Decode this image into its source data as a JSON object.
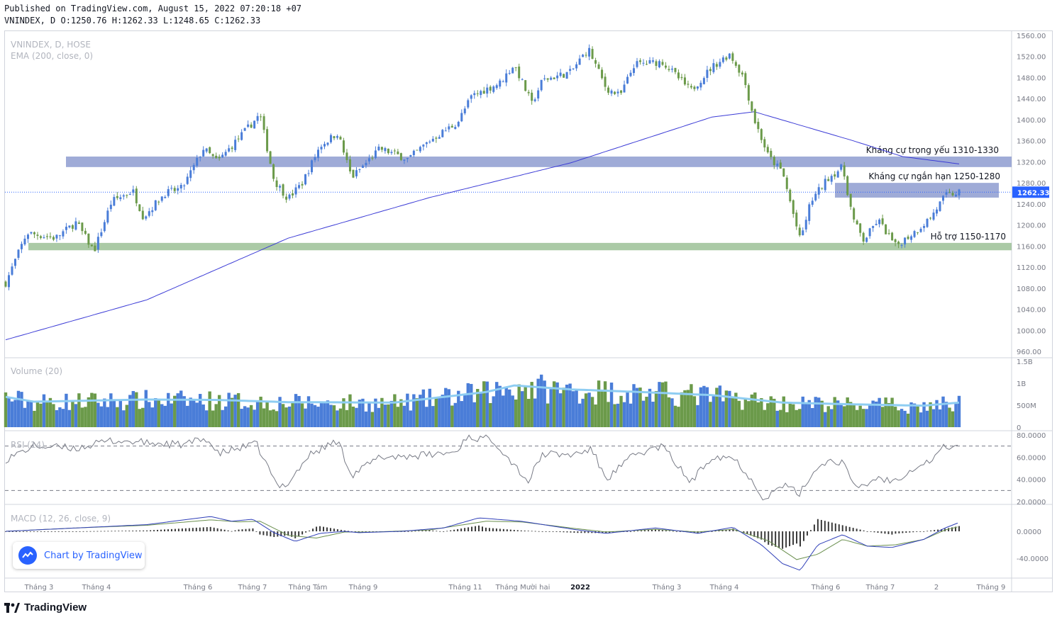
{
  "header": {
    "published": "Published on TradingView.com, August 15, 2022 07:20:18 +07",
    "ohlc": "VNINDEX, D O:1250.76 H:1262.33 L:1248.65 C:1262.33"
  },
  "legend": {
    "symbol": "VNINDEX, D, HOSE",
    "ema": "EMA (200, close, 0)",
    "volume": "Volume (20)",
    "rsi": "RSI (14)",
    "macd": "MACD (12, 26, close, 9)"
  },
  "price_axis": {
    "ticks": [
      "1560.00",
      "1520.00",
      "1480.00",
      "1440.00",
      "1400.00",
      "1360.00",
      "1320.00",
      "1280.00",
      "1240.00",
      "1200.00",
      "1160.00",
      "1120.00",
      "1080.00",
      "1040.00",
      "1000.00",
      "960.00"
    ],
    "last_price": "1262.33"
  },
  "volume_axis": {
    "ticks": [
      "1.5B",
      "1B",
      "500M",
      "0"
    ]
  },
  "rsi_axis": {
    "ticks": [
      "80.0000",
      "60.0000",
      "40.0000",
      "20.0000"
    ]
  },
  "macd_axis": {
    "ticks": [
      "0.0000",
      "-40.0000"
    ]
  },
  "time_axis": {
    "labels": [
      "Tháng 3",
      "Tháng 4",
      "Tháng 6",
      "Tháng 7",
      "Tháng Tám",
      "Tháng 9",
      "Tháng 11",
      "Tháng Mười hai",
      "2022",
      "Tháng 3",
      "Tháng 4",
      "Tháng 6",
      "Tháng 7",
      "2",
      "Tháng 9"
    ],
    "bold": [
      "2022"
    ]
  },
  "zones": [
    {
      "label": "Kháng cự trọng yếu 1310-1330",
      "low": 1310,
      "high": 1330,
      "color": "#7f8fc9"
    },
    {
      "label": "Kháng cự ngắn hạn 1250-1280",
      "low": 1252,
      "high": 1280,
      "color": "#7f8fc9"
    },
    {
      "label": "Hỗ trợ 1150-1170",
      "low": 1152,
      "high": 1166,
      "color": "#8fb888"
    }
  ],
  "colors": {
    "up": "#4a7dd8",
    "down": "#6b9a4a",
    "ema": "#3b3bd6",
    "vol_ma": "#8ecdf2",
    "macd": "#2f3fb8",
    "signal": "#6a8f4e",
    "badge_text": "#2962ff"
  },
  "badge": {
    "text": "Chart by TradingView"
  },
  "brand": {
    "text": "TradingView"
  },
  "chart_data": {
    "type": "candlestick",
    "title": "VNINDEX, D, HOSE",
    "ylim": [
      950,
      1565
    ],
    "price_path": [
      [
        0,
        1090
      ],
      [
        30,
        1185
      ],
      [
        70,
        1175
      ],
      [
        100,
        1205
      ],
      [
        125,
        1150
      ],
      [
        150,
        1245
      ],
      [
        180,
        1265
      ],
      [
        195,
        1215
      ],
      [
        225,
        1260
      ],
      [
        250,
        1270
      ],
      [
        280,
        1345
      ],
      [
        300,
        1320
      ],
      [
        340,
        1380
      ],
      [
        360,
        1410
      ],
      [
        380,
        1285
      ],
      [
        400,
        1250
      ],
      [
        420,
        1280
      ],
      [
        445,
        1350
      ],
      [
        470,
        1375
      ],
      [
        490,
        1290
      ],
      [
        530,
        1345
      ],
      [
        570,
        1325
      ],
      [
        600,
        1360
      ],
      [
        640,
        1395
      ],
      [
        660,
        1445
      ],
      [
        700,
        1470
      ],
      [
        720,
        1505
      ],
      [
        745,
        1430
      ],
      [
        760,
        1475
      ],
      [
        800,
        1490
      ],
      [
        825,
        1535
      ],
      [
        850,
        1460
      ],
      [
        870,
        1445
      ],
      [
        890,
        1505
      ],
      [
        930,
        1510
      ],
      [
        970,
        1455
      ],
      [
        1000,
        1500
      ],
      [
        1025,
        1525
      ],
      [
        1045,
        1480
      ],
      [
        1060,
        1400
      ],
      [
        1080,
        1330
      ],
      [
        1100,
        1300
      ],
      [
        1125,
        1170
      ],
      [
        1140,
        1245
      ],
      [
        1165,
        1290
      ],
      [
        1185,
        1310
      ],
      [
        1200,
        1210
      ],
      [
        1215,
        1170
      ],
      [
        1235,
        1210
      ],
      [
        1260,
        1160
      ],
      [
        1290,
        1190
      ],
      [
        1310,
        1215
      ],
      [
        1330,
        1255
      ],
      [
        1350,
        1262.33
      ]
    ],
    "ema200_path": [
      [
        0,
        982
      ],
      [
        200,
        1058
      ],
      [
        400,
        1175
      ],
      [
        600,
        1252
      ],
      [
        800,
        1318
      ],
      [
        1000,
        1405
      ],
      [
        1060,
        1415
      ],
      [
        1200,
        1360
      ],
      [
        1270,
        1330
      ],
      [
        1350,
        1316
      ]
    ],
    "rsi_path": [
      [
        0,
        58
      ],
      [
        40,
        70
      ],
      [
        100,
        68
      ],
      [
        150,
        75
      ],
      [
        200,
        73
      ],
      [
        250,
        71
      ],
      [
        285,
        77
      ],
      [
        300,
        63
      ],
      [
        355,
        72
      ],
      [
        385,
        33
      ],
      [
        400,
        37
      ],
      [
        430,
        62
      ],
      [
        470,
        75
      ],
      [
        490,
        44
      ],
      [
        530,
        60
      ],
      [
        600,
        62
      ],
      [
        640,
        65
      ],
      [
        650,
        78
      ],
      [
        690,
        76
      ],
      [
        740,
        38
      ],
      [
        760,
        63
      ],
      [
        800,
        62
      ],
      [
        830,
        67
      ],
      [
        850,
        40
      ],
      [
        890,
        62
      ],
      [
        930,
        70
      ],
      [
        970,
        37
      ],
      [
        1000,
        61
      ],
      [
        1030,
        60
      ],
      [
        1050,
        45
      ],
      [
        1075,
        22
      ],
      [
        1100,
        35
      ],
      [
        1125,
        27
      ],
      [
        1140,
        44
      ],
      [
        1160,
        56
      ],
      [
        1185,
        56
      ],
      [
        1200,
        34
      ],
      [
        1215,
        34
      ],
      [
        1235,
        42
      ],
      [
        1255,
        38
      ],
      [
        1290,
        52
      ],
      [
        1310,
        57
      ],
      [
        1330,
        70
      ],
      [
        1350,
        69
      ]
    ],
    "macd_path": [
      [
        0,
        0
      ],
      [
        100,
        5
      ],
      [
        200,
        10
      ],
      [
        290,
        22
      ],
      [
        320,
        15
      ],
      [
        350,
        18
      ],
      [
        380,
        -2
      ],
      [
        410,
        -15
      ],
      [
        445,
        -3
      ],
      [
        480,
        0
      ],
      [
        500,
        -2
      ],
      [
        560,
        0
      ],
      [
        620,
        5
      ],
      [
        670,
        20
      ],
      [
        730,
        15
      ],
      [
        810,
        2
      ],
      [
        850,
        -3
      ],
      [
        920,
        5
      ],
      [
        980,
        -3
      ],
      [
        1030,
        6
      ],
      [
        1070,
        -20
      ],
      [
        1100,
        -48
      ],
      [
        1125,
        -58
      ],
      [
        1150,
        -20
      ],
      [
        1185,
        -5
      ],
      [
        1220,
        -22
      ],
      [
        1255,
        -24
      ],
      [
        1300,
        -12
      ],
      [
        1330,
        5
      ],
      [
        1350,
        13
      ]
    ],
    "signal_path": [
      [
        0,
        0
      ],
      [
        100,
        5
      ],
      [
        200,
        9
      ],
      [
        290,
        17
      ],
      [
        330,
        14
      ],
      [
        360,
        15
      ],
      [
        400,
        -6
      ],
      [
        440,
        -10
      ],
      [
        480,
        -1
      ],
      [
        520,
        -1
      ],
      [
        600,
        2
      ],
      [
        680,
        15
      ],
      [
        730,
        14
      ],
      [
        800,
        5
      ],
      [
        850,
        -1
      ],
      [
        920,
        3
      ],
      [
        980,
        -1
      ],
      [
        1030,
        3
      ],
      [
        1080,
        -14
      ],
      [
        1120,
        -42
      ],
      [
        1150,
        -34
      ],
      [
        1185,
        -12
      ],
      [
        1220,
        -22
      ],
      [
        1260,
        -20
      ],
      [
        1300,
        -12
      ],
      [
        1330,
        2
      ],
      [
        1350,
        7
      ]
    ],
    "volume_ma_path": [
      [
        0,
        690
      ],
      [
        40,
        580
      ],
      [
        200,
        630
      ],
      [
        300,
        620
      ],
      [
        400,
        570
      ],
      [
        550,
        560
      ],
      [
        680,
        800
      ],
      [
        720,
        950
      ],
      [
        800,
        860
      ],
      [
        900,
        800
      ],
      [
        1000,
        730
      ],
      [
        1100,
        560
      ],
      [
        1200,
        520
      ],
      [
        1300,
        490
      ],
      [
        1350,
        560
      ]
    ],
    "rsi_levels": [
      70,
      30
    ]
  }
}
